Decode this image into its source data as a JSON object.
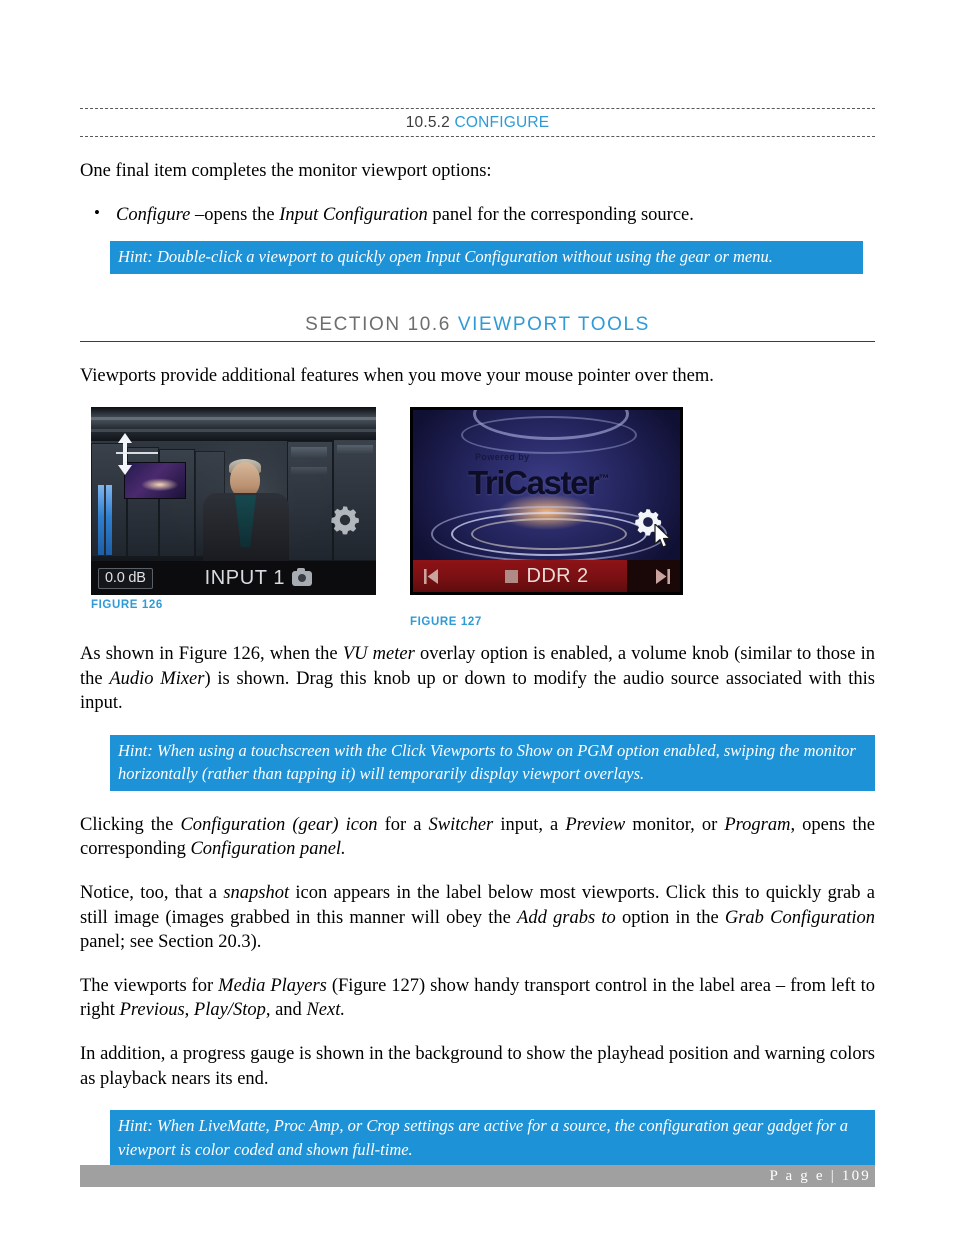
{
  "document": {
    "subheading": {
      "number": "10.5.2",
      "title": "CONFIGURE"
    },
    "section_heading": {
      "number": "SECTION 10.6",
      "title": "VIEWPORT TOOLS"
    },
    "intro_paragraph": "One final item completes the monitor viewport options:",
    "bullets": [
      {
        "term": "Configure",
        "text": " –opens the ",
        "term2": "Input Configuration",
        "text2": " panel for the corresponding source."
      }
    ],
    "hints": [
      "Hint: Double-click a viewport to quickly open Input Configuration without using the gear or menu.",
      "Hint: When using a touchscreen with the Click Viewports to Show on PGM option enabled, swiping the monitor horizontally (rather than tapping it) will temporarily display viewport overlays.",
      "Hint: When LiveMatte, Proc Amp, or Crop settings are active for a source, the configuration gear gadget for a viewport is color coded  and shown full-time."
    ],
    "paragraphs": {
      "viewports_intro": "Viewports provide additional features when you move your mouse pointer over them.",
      "p_vu_a": "As shown in Figure 126, when the ",
      "p_vu_vu": "VU meter",
      "p_vu_b": " overlay option is enabled, a volume knob (similar to those in the ",
      "p_vu_mixer": "Audio Mixer",
      "p_vu_c": ") is shown.  Drag this knob up or down to modify the audio source associated with this input.",
      "p_gear_a": "Clicking the ",
      "p_gear_icon": "Configuration (gear) icon",
      "p_gear_b": " for a ",
      "p_gear_switcher": "Switcher",
      "p_gear_c": " input, a ",
      "p_gear_preview": "Preview",
      "p_gear_d": " monitor, or ",
      "p_gear_program": "Program",
      "p_gear_e": ", opens the corresponding ",
      "p_gear_panel": "Configuration panel.",
      "p_snap_a": "Notice, too, that a ",
      "p_snap_snapshot": "snapshot",
      "p_snap_b": " icon appears in the label below most viewports.  Click this to quickly grab a still image (images grabbed in this manner will obey the ",
      "p_snap_add": "Add grabs to",
      "p_snap_c": " option in the ",
      "p_snap_grab": "Grab Configuration",
      "p_snap_d": " panel; see Section 20.3).",
      "p_media_a": "The viewports for ",
      "p_media_players": "Media Players",
      "p_media_b": " (Figure 127) show handy transport control in the label area – from left to right ",
      "p_media_prev": "Previous",
      "p_media_c": ", ",
      "p_media_playstop": "Play/Stop",
      "p_media_d": ", and ",
      "p_media_next": "Next.",
      "p_gauge": "In addition, a progress gauge is shown in the background to show the playhead position and warning colors as playback nears its end."
    },
    "figures": [
      {
        "caption": "FIGURE 126",
        "viewport": {
          "db_readout": "0.0 dB",
          "label": "INPUT 1",
          "icons": [
            "volume-knob-arrow",
            "vu-meter",
            "gear-icon",
            "snapshot-camera-icon"
          ]
        }
      },
      {
        "caption": "FIGURE 127",
        "viewport": {
          "brand_small": "Powered by",
          "brand": "TriCaster",
          "brand_tm": "™",
          "label": "DDR 2",
          "icons": [
            "previous-icon",
            "stop-icon",
            "next-icon",
            "gear-icon",
            "mouse-cursor-icon"
          ]
        }
      }
    ],
    "footer": {
      "page_label": "P a g e  | 109"
    },
    "colors": {
      "accent_blue": "#2e9bd6",
      "hint_background": "#1e92d6",
      "heading_gray": "#6e6e6e",
      "footer_gray": "#a0a0a0"
    }
  }
}
